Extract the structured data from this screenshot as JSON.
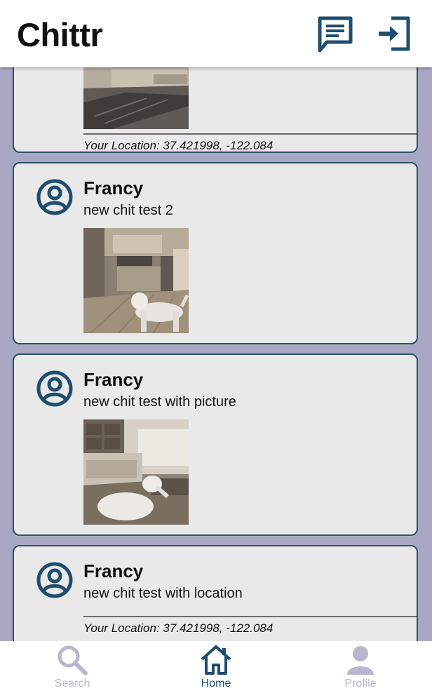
{
  "header": {
    "title": "Chittr",
    "chits_icon": "message-icon",
    "login_icon": "sign-in-icon"
  },
  "colors": {
    "background": "#a9a8c4",
    "card": "#e9e9ea",
    "accent": "#1f4d6e",
    "nav_inactive": "#b9b6cf"
  },
  "chits": [
    {
      "image": "living-room-photo",
      "location_label": "Your Location: 37.421998, -122.084"
    },
    {
      "author": "Francy",
      "text": "new chit test 2",
      "image": "kitchen-with-dog-photo"
    },
    {
      "author": "Francy",
      "text": "new chit test with picture",
      "image": "living-room-with-dog-photo"
    },
    {
      "author": "Francy",
      "text": "new chit test with location",
      "location_label": "Your Location: 37.421998, -122.084"
    }
  ],
  "nav": {
    "search": {
      "label": "Search",
      "icon": "search-icon",
      "active": false
    },
    "home": {
      "label": "Home",
      "icon": "home-icon",
      "active": true
    },
    "profile": {
      "label": "Profile",
      "icon": "person-icon",
      "active": false
    }
  }
}
